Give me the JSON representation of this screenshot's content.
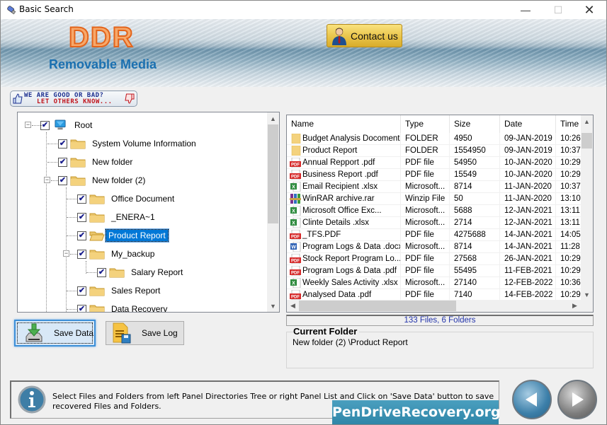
{
  "window": {
    "title": "Basic Search",
    "controls": {
      "minimize": "—",
      "maximize": "☐",
      "close": "✕"
    }
  },
  "header": {
    "logo": "DDR",
    "subtitle": "Removable Media",
    "contact_label": "Contact us"
  },
  "feedback": {
    "line1": "WE ARE GOOD OR BAD?",
    "line2": "LET OTHERS KNOW..."
  },
  "tree": {
    "nodes": [
      {
        "label": "Root",
        "checked": true,
        "expanded": true,
        "icon": "computer-icon"
      },
      {
        "label": "System Volume Information",
        "checked": true,
        "icon": "folder-icon"
      },
      {
        "label": "New folder",
        "checked": true,
        "icon": "folder-icon"
      },
      {
        "label": "New folder (2)",
        "checked": true,
        "expanded": true,
        "icon": "folder-icon"
      },
      {
        "label": "Office Document",
        "checked": true,
        "icon": "folder-icon"
      },
      {
        "label": "_ENERA~1",
        "checked": true,
        "icon": "folder-icon"
      },
      {
        "label": "Product Report",
        "checked": true,
        "selected": true,
        "icon": "folder-open-icon"
      },
      {
        "label": "My_backup",
        "checked": true,
        "expanded": true,
        "icon": "folder-icon"
      },
      {
        "label": "Salary Report",
        "checked": true,
        "icon": "folder-icon"
      },
      {
        "label": "Sales Report",
        "checked": true,
        "icon": "folder-icon"
      },
      {
        "label": "Data Recovery",
        "checked": true,
        "icon": "folder-icon"
      }
    ]
  },
  "file_list": {
    "columns": [
      "Name",
      "Type",
      "Size",
      "Date",
      "Time"
    ],
    "rows": [
      {
        "icon": "folder",
        "name": "Budget  Analysis Docoments",
        "type": "FOLDER",
        "size": "4950",
        "date": "09-JAN-2019",
        "time": "10:26"
      },
      {
        "icon": "folder",
        "name": "Product Report",
        "type": "FOLDER",
        "size": "1554950",
        "date": "09-JAN-2019",
        "time": "10:37"
      },
      {
        "icon": "pdf",
        "name": "Annual Repport .pdf",
        "type": "PDF file",
        "size": "54950",
        "date": "10-JAN-2020",
        "time": "10:29"
      },
      {
        "icon": "pdf",
        "name": "Business Report .pdf",
        "type": "PDF file",
        "size": "15549",
        "date": "10-JAN-2020",
        "time": "10:29"
      },
      {
        "icon": "excel",
        "name": "Email Recipient .xlsx",
        "type": "Microsoft...",
        "size": "8714",
        "date": "11-JAN-2020",
        "time": "10:37"
      },
      {
        "icon": "rar",
        "name": "WinRAR archive.rar",
        "type": "Winzip File",
        "size": "50",
        "date": "11-JAN-2020",
        "time": "13:10"
      },
      {
        "icon": "excel",
        "name": "Microsoft Office Exc...",
        "type": "Microsoft...",
        "size": "5688",
        "date": "12-JAN-2021",
        "time": "13:11"
      },
      {
        "icon": "excel",
        "name": "Clinte Details .xlsx",
        "type": "Microsoft...",
        "size": "2714",
        "date": "12-JAN-2021",
        "time": "13:11"
      },
      {
        "icon": "pdf",
        "name": "_TFS.PDF",
        "type": "PDF file",
        "size": "4275688",
        "date": "14-JAN-2021",
        "time": "14:05"
      },
      {
        "icon": "word",
        "name": "Program Logs & Data .docx",
        "type": "Microsoft...",
        "size": "8714",
        "date": "14-JAN-2021",
        "time": "11:28"
      },
      {
        "icon": "pdf",
        "name": "Stock Report Program Lo...",
        "type": "PDF file",
        "size": "27568",
        "date": "26-JAN-2021",
        "time": "10:29"
      },
      {
        "icon": "pdf",
        "name": "Program Logs & Data .pdf",
        "type": "PDF file",
        "size": "55495",
        "date": "11-FEB-2021",
        "time": "10:29"
      },
      {
        "icon": "excel",
        "name": "Weekly Sales Activity .xlsx",
        "type": "Microsoft...",
        "size": "27140",
        "date": "12-FEB-2022",
        "time": "10:36"
      },
      {
        "icon": "pdf",
        "name": "Analysed Data .pdf",
        "type": "PDF file",
        "size": "7140",
        "date": "14-FEB-2022",
        "time": "10:29"
      }
    ]
  },
  "status": {
    "count": "133 Files, 6 Folders",
    "current_folder_title": "Current Folder",
    "current_folder_path": "New folder (2) \\Product Report"
  },
  "buttons": {
    "save_data": "Save Data",
    "save_log": "Save Log"
  },
  "info": {
    "message": "Select Files and Folders from left Panel Directories Tree or right Panel List and Click on 'Save Data' button to save recovered Files and Folders.",
    "watermark": "PenDriveRecovery.org"
  },
  "colors": {
    "selection": "#0078d7",
    "count_text": "#2233aa",
    "logo_orange": "#e3641b",
    "subtitle_blue": "#1b70b0",
    "watermark_bg": "#2f86a8"
  }
}
